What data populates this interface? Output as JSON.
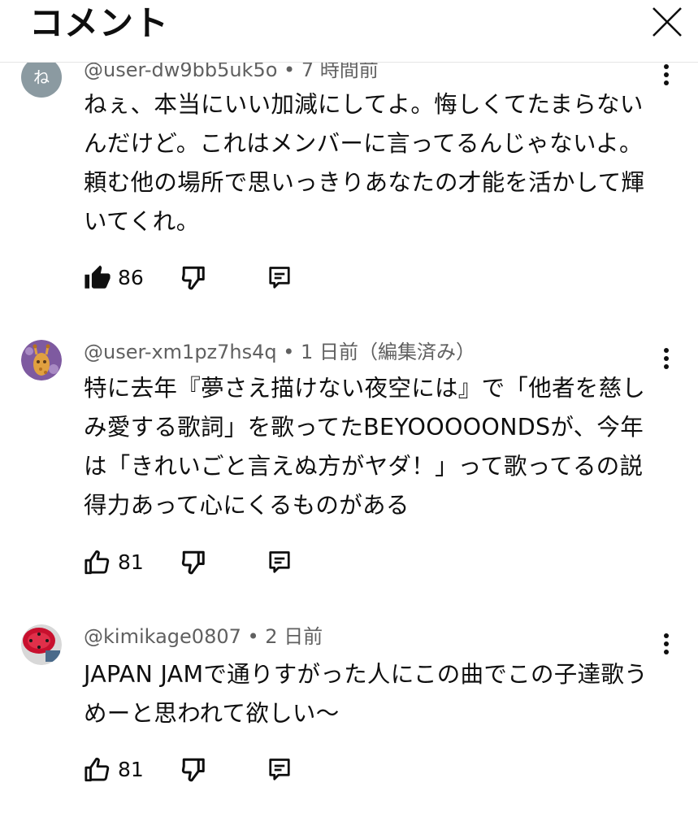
{
  "header": {
    "title": "コメント",
    "close_icon": "close-icon"
  },
  "comments": [
    {
      "avatar_letter": "ね",
      "avatar_color": "#8b9aa1",
      "meta": "@user-dw9bb5uk5o • 7 時間前",
      "text": "ねぇ、本当にいい加減にしてよ。悔しくてたまらないんだけど。これはメンバーに言ってるんじゃないよ。頼む他の場所で思いっきりあなたの才能を活かして輝いてくれ。",
      "likes": "86",
      "liked": true
    },
    {
      "avatar_icon": "giraffe-avatar",
      "meta": "@user-xm1pz7hs4q • 1 日前（編集済み）",
      "text": "特に去年『夢さえ描けない夜空には』で「他者を慈しみ愛する歌詞」を歌ってたBEYOOOOONDSが、今年は「きれいごと言えぬ方がヤダ！」って歌ってるの説得力あって心にくるものがある",
      "likes": "81",
      "liked": false
    },
    {
      "avatar_icon": "red-drum-avatar",
      "meta": "@kimikage0807 • 2 日前",
      "text": "JAPAN JAMで通りすがった人にこの曲でこの子達歌うめーと思われて欲しい〜",
      "likes": "81",
      "liked": false
    }
  ]
}
